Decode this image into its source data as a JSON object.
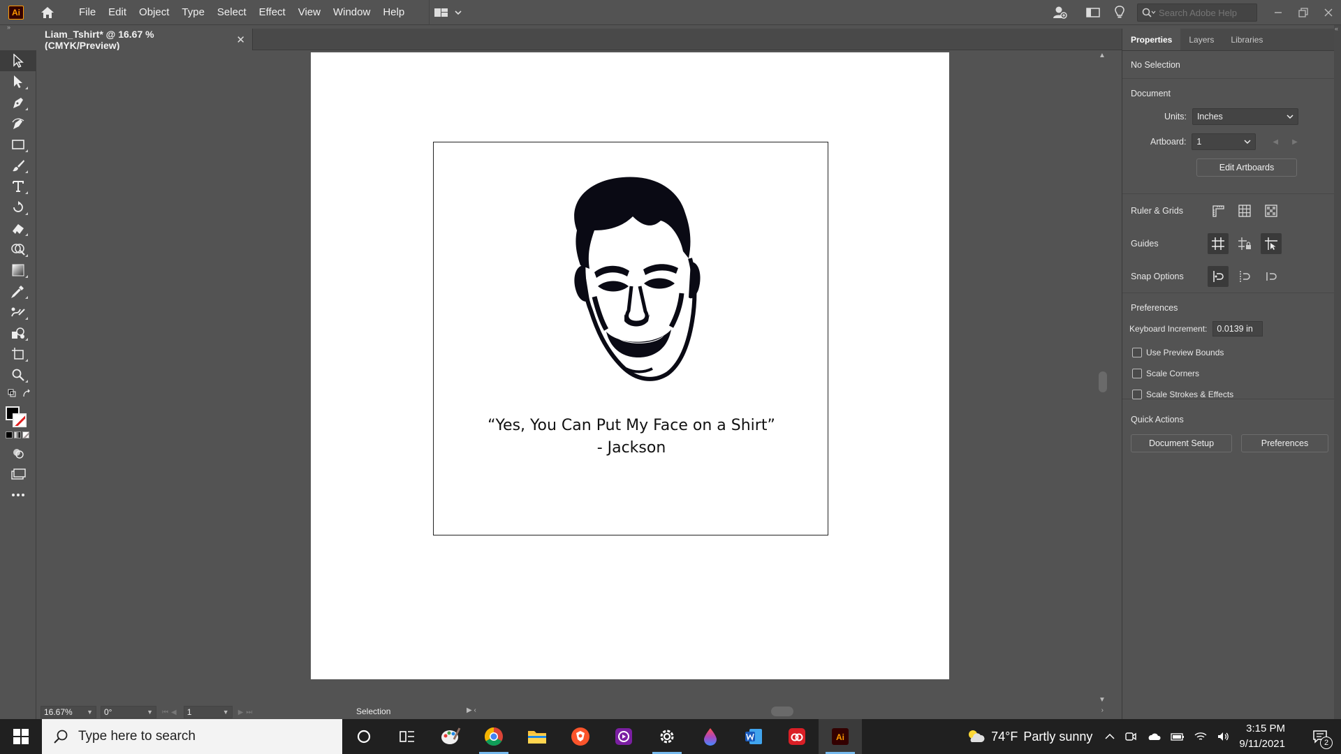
{
  "app": {
    "logo_text": "Ai",
    "brand_color": "#ff9a00"
  },
  "menu": [
    "File",
    "Edit",
    "Object",
    "Type",
    "Select",
    "Effect",
    "View",
    "Window",
    "Help"
  ],
  "search_help": {
    "placeholder": "Search Adobe Help"
  },
  "document_tab": {
    "title": "Liam_Tshirt* @ 16.67 % (CMYK/Preview)",
    "close_glyph": "✕"
  },
  "artwork": {
    "quote_line1": "“Yes, You Can Put My Face on a Shirt”",
    "quote_line2": "- Jackson"
  },
  "status_bar": {
    "zoom": "16.67%",
    "rotation": "0°",
    "artboard_number": "1",
    "current_tool": "Selection"
  },
  "properties_panel": {
    "tabs": [
      "Properties",
      "Layers",
      "Libraries"
    ],
    "selection_state": "No Selection",
    "document_heading": "Document",
    "units_label": "Units:",
    "units_value": "Inches",
    "artboard_label": "Artboard:",
    "artboard_value": "1",
    "edit_artboards": "Edit Artboards",
    "ruler_grids_label": "Ruler & Grids",
    "guides_label": "Guides",
    "snap_options_label": "Snap Options",
    "preferences_heading": "Preferences",
    "keyboard_increment_label": "Keyboard Increment:",
    "keyboard_increment_value": "0.0139 in",
    "checkboxes": [
      "Use Preview Bounds",
      "Scale Corners",
      "Scale Strokes & Effects"
    ],
    "quick_actions_heading": "Quick Actions",
    "document_setup_button": "Document Setup",
    "preferences_button": "Preferences"
  },
  "taskbar": {
    "search_placeholder": "Type here to search",
    "weather_temp": "74°F",
    "weather_desc": "Partly sunny",
    "time": "3:15 PM",
    "date": "9/11/2021",
    "notification_count": "2"
  }
}
